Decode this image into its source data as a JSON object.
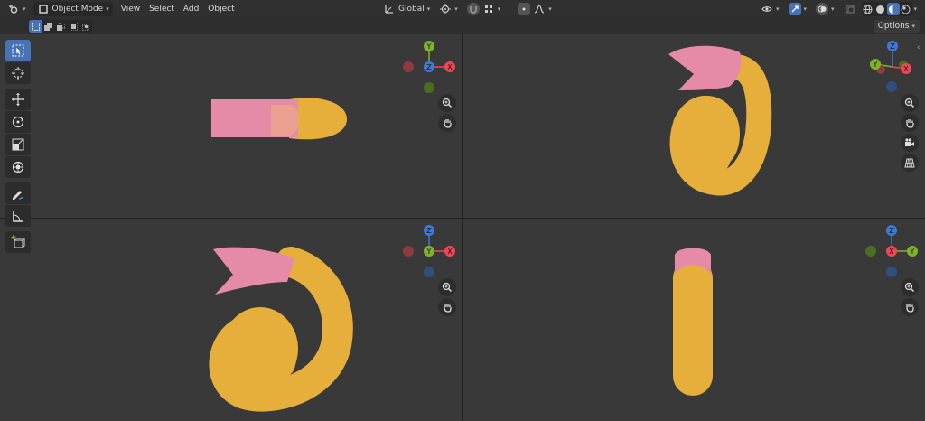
{
  "header": {
    "editor_type_icon": "editor-type-icon",
    "mode": "Object Mode",
    "menus": [
      "View",
      "Select",
      "Add",
      "Object"
    ],
    "transform_orientation": "Global"
  },
  "subbar": {
    "options_label": "Options"
  },
  "gizmo_labels": {
    "x": "X",
    "y": "Y",
    "z": "Z"
  },
  "colors": {
    "x_axis": "#f04655",
    "y_axis": "#7fb32c",
    "z_axis": "#3b7bd6",
    "active": "#4772b3",
    "tube_yellow": "#e6ae3a",
    "tube_pink": "#e58aa7"
  },
  "toolbar": [
    "select-box",
    "cursor",
    "move",
    "rotate",
    "scale",
    "transform",
    "annotate",
    "measure",
    "add-cube"
  ]
}
